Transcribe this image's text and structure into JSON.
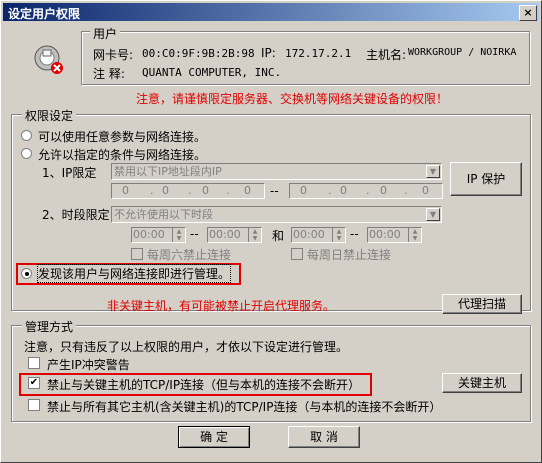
{
  "window": {
    "title": "设定用户权限",
    "close_glyph": "×"
  },
  "user": {
    "section_label": "用户",
    "mac_label": "网卡号:",
    "mac_value": "00:C0:9F:9B:2B:98",
    "ip_label": "IP:",
    "ip_value": "172.17.2.1",
    "host_label": "主机名:",
    "host_value": "WORKGROUP / NOIRKA",
    "note_label": "注  释:",
    "note_value": "QUANTA COMPUTER, INC."
  },
  "warning_text": "注意，请谨慎限定服务器、交换机等网络关键设备的权限！",
  "permission": {
    "section_label": "权限设定",
    "opt_any": "可以使用任意参数与网络连接。",
    "opt_conditional": "允许以指定的条件与网络连接。",
    "ip_limit_label": "1、IP限定",
    "ip_combo_value": "禁用以下IP地址段内IP",
    "ip_from": [
      "0",
      "0",
      "0",
      "0"
    ],
    "ip_to": [
      "0",
      "0",
      "0",
      "0"
    ],
    "dash": "--",
    "dot": ".",
    "ip_protect_button": "IP 保护",
    "time_limit_label": "2、时段限定",
    "time_combo_value": "不允许使用以下时段",
    "time1_start": "00:00",
    "time1_end": "00:00",
    "and_label": "和",
    "time2_start": "00:00",
    "time2_end": "00:00",
    "sat_label": "每周六禁止连接",
    "sun_label": "每周日禁止连接",
    "opt_manage": "发现该用户与网络连接即进行管理。"
  },
  "non_key_host_text": "非关键主机，有可能被禁止开启代理服务。",
  "proxy_scan_button": "代理扫描",
  "manage": {
    "section_label": "管理方式",
    "note": "注意，只有违反了以上权限的用户，才依以下设定进行管理。",
    "opt_ip_conflict": "产生IP冲突警告",
    "opt_block_key": "禁止与关键主机的TCP/IP连接（但与本机的连接不会断开）",
    "key_host_button": "关键主机",
    "opt_block_all": "禁止与所有其它主机(含关键主机)的TCP/IP连接（与本机的连接不会断开）",
    "check_glyph": "✔"
  },
  "buttons": {
    "ok": "确 定",
    "cancel": "取 消"
  }
}
